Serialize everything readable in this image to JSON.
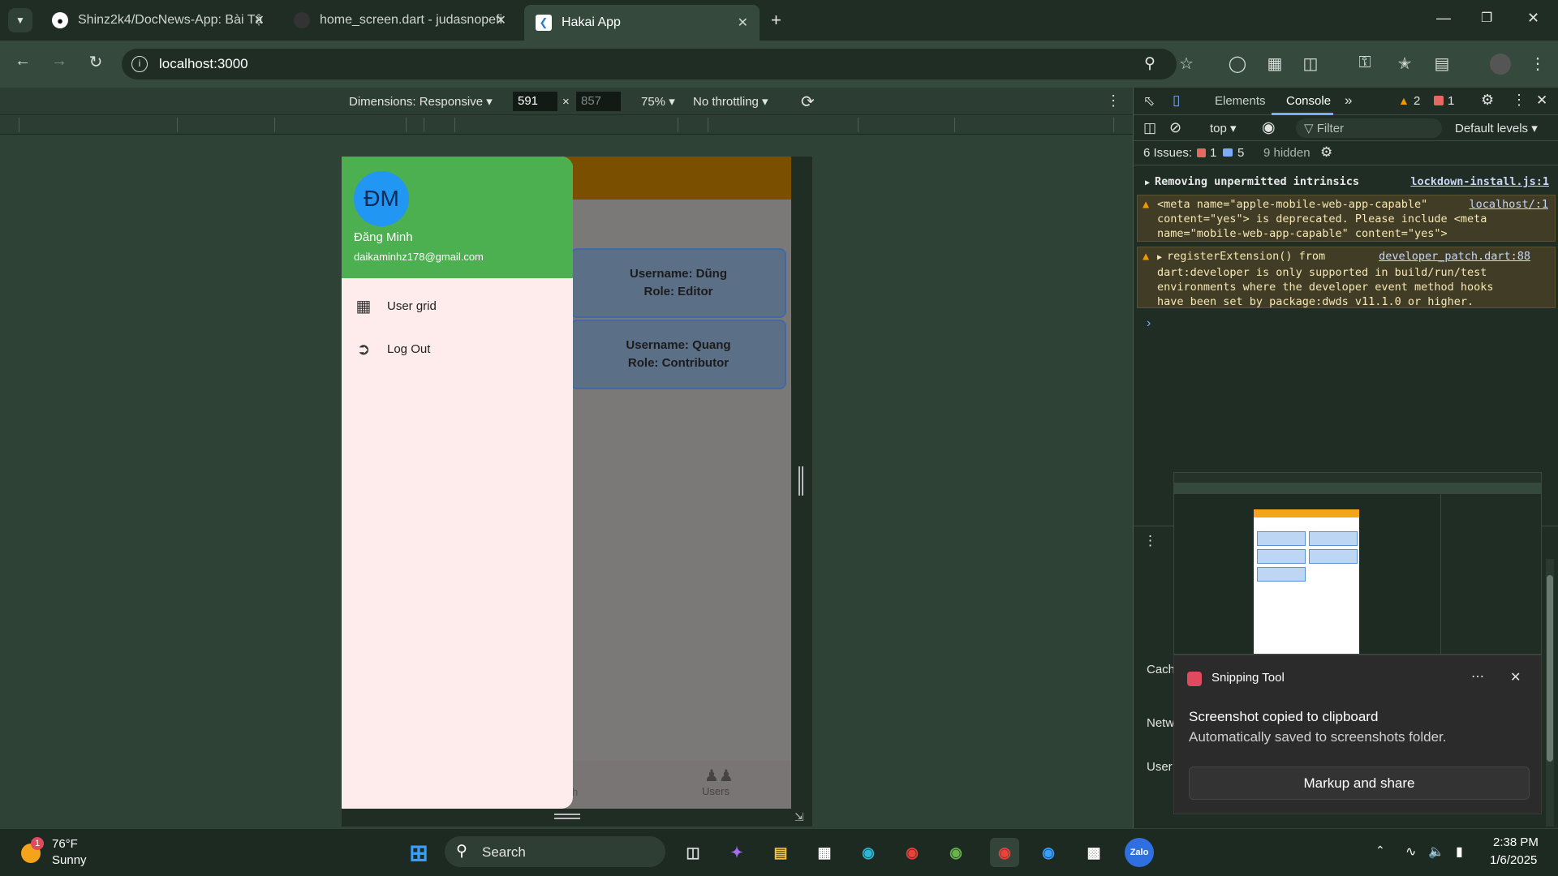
{
  "browser": {
    "tabs": [
      {
        "title": "Shinz2k4/DocNews-App: Bài Tậ",
        "icon": "github-icon"
      },
      {
        "title": "home_screen.dart - judasnopefi",
        "icon": "github-icon"
      },
      {
        "title": "Hakai App",
        "icon": "flutter-icon"
      }
    ],
    "url": "localhost:3000"
  },
  "device_toolbar": {
    "dimensions_label": "Dimensions: Responsive",
    "width": "591",
    "times": "×",
    "height": "857",
    "zoom": "75%",
    "throttling": "No throttling"
  },
  "app": {
    "cards": [
      {
        "username": "Username: Dũng",
        "role": "Role: Editor"
      },
      {
        "username": "Username: Quang",
        "role": "Role: Contributor"
      }
    ],
    "nav_partial": "h",
    "nav_users": "Users",
    "drawer": {
      "avatar_initials": "ĐM",
      "name": "Đăng Minh",
      "email": "daikaminhz178@gmail.com",
      "items": [
        {
          "label": "User grid",
          "icon": "grid-icon"
        },
        {
          "label": "Log Out",
          "icon": "logout-icon"
        }
      ]
    }
  },
  "devtools": {
    "tabs": [
      "Elements",
      "Console"
    ],
    "warnings_count": "2",
    "errors_count": "1",
    "context": "top",
    "filter_placeholder": "Filter",
    "levels": "Default levels",
    "issues_label": "6 Issues:",
    "issues_errors": "1",
    "issues_info": "5",
    "hidden": "9 hidden",
    "messages": [
      {
        "text": "Removing unpermitted intrinsics",
        "link": "lockdown-install.js:1"
      },
      {
        "line1": "<meta name=\"apple-mobile-web-app-capable\"",
        "link": "localhost/:1",
        "line2": "content=\"yes\"> is deprecated. Please include <meta",
        "line3": "name=\"mobile-web-app-capable\" content=\"yes\">"
      },
      {
        "line1": "registerExtension() from",
        "link": "developer_patch.dart:88",
        "line2": "dart:developer is only supported in build/run/test",
        "line3": "environments where the developer event method hooks",
        "line4": "have been set by package:dwds v11.1.0 or higher."
      }
    ],
    "drawer_partial": [
      "Cach",
      "Netw",
      "User"
    ]
  },
  "toast": {
    "app": "Snipping Tool",
    "title": "Screenshot copied to clipboard",
    "subtitle": "Automatically saved to screenshots folder.",
    "button": "Markup and share"
  },
  "taskbar": {
    "weather_temp": "76°F",
    "weather_desc": "Sunny",
    "weather_badge": "1",
    "search": "Search",
    "time": "2:38 PM",
    "date": "1/6/2025"
  }
}
